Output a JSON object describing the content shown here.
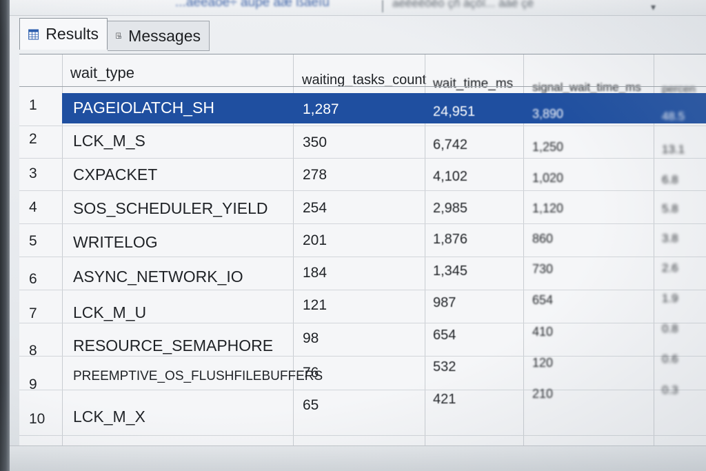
{
  "toolbar": {
    "query_text": "...àêéàôê÷ äüpé äæ ßáêïü",
    "path_text": "aéêèêõêó çñ àçôî... àáé çè",
    "chevron": "▾"
  },
  "tabs": [
    {
      "label": "Results",
      "icon": "grid-icon",
      "active": true
    },
    {
      "label": "Messages",
      "icon": "document-icon",
      "active": false
    }
  ],
  "grid": {
    "columns": [
      "wait_type",
      "waiting_tasks_count",
      "wait_time_ms",
      "signal_wait_time_ms",
      "percen"
    ],
    "rows": [
      {
        "n": "1",
        "wait_type": "PAGEIOLATCH_SH",
        "waiting_tasks_count": "1,287",
        "wait_time_ms": "24,951",
        "signal_wait_time_ms": "3,890",
        "pct": "48.5"
      },
      {
        "n": "2",
        "wait_type": "LCK_M_S",
        "waiting_tasks_count": "350",
        "wait_time_ms": "6,742",
        "signal_wait_time_ms": "1,250",
        "pct": "13.1"
      },
      {
        "n": "3",
        "wait_type": "CXPACKET",
        "waiting_tasks_count": "278",
        "wait_time_ms": "4,102",
        "signal_wait_time_ms": "1,020",
        "pct": "6.8"
      },
      {
        "n": "4",
        "wait_type": "SOS_SCHEDULER_YIELD",
        "waiting_tasks_count": "254",
        "wait_time_ms": "2,985",
        "signal_wait_time_ms": "1,120",
        "pct": "5.8"
      },
      {
        "n": "5",
        "wait_type": "WRITELOG",
        "waiting_tasks_count": "201",
        "wait_time_ms": "1,876",
        "signal_wait_time_ms": "860",
        "pct": "3.8"
      },
      {
        "n": "6",
        "wait_type": "ASYNC_NETWORK_IO",
        "waiting_tasks_count": "184",
        "wait_time_ms": "1,345",
        "signal_wait_time_ms": "730",
        "pct": "2.6"
      },
      {
        "n": "7",
        "wait_type": "LCK_M_U",
        "waiting_tasks_count": "121",
        "wait_time_ms": "987",
        "signal_wait_time_ms": "654",
        "pct": "1.9"
      },
      {
        "n": "8",
        "wait_type": "RESOURCE_SEMAPHORE",
        "waiting_tasks_count": "98",
        "wait_time_ms": "654",
        "signal_wait_time_ms": "410",
        "pct": "0.8"
      },
      {
        "n": "9",
        "wait_type": "PREEMPTIVE_OS_FLUSHFILEBUFFERS",
        "waiting_tasks_count": "76",
        "wait_time_ms": "532",
        "signal_wait_time_ms": "120",
        "pct": "0.6"
      },
      {
        "n": "10",
        "wait_type": "LCK_M_X",
        "waiting_tasks_count": "65",
        "wait_time_ms": "421",
        "signal_wait_time_ms": "210",
        "pct": "0.3"
      }
    ],
    "selected_row": 0
  },
  "colors": {
    "selection": "#1f4fa0",
    "grid_line": "#c8ccd1",
    "text": "#1f2226"
  }
}
